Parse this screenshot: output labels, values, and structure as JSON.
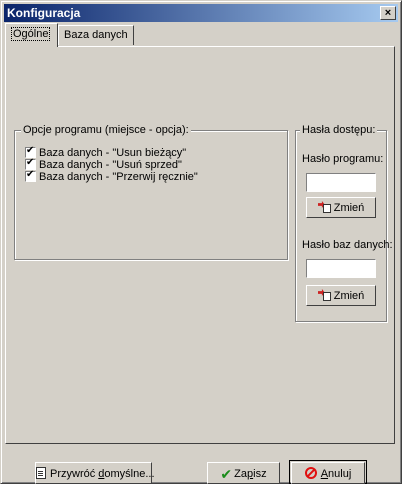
{
  "window": {
    "title": "Konfiguracja",
    "close_label": "×"
  },
  "tabs": [
    {
      "label": "Ogólne",
      "active": true
    },
    {
      "label": "Baza danych",
      "active": false
    }
  ],
  "options_group": {
    "legend": "Opcje programu (miejsce - opcja):",
    "items": [
      {
        "label": "Baza danych - \"Usun bieżący\"",
        "checked": true
      },
      {
        "label": "Baza danych - \"Usuń sprzed\"",
        "checked": true
      },
      {
        "label": "Baza danych - \"Przerwij ręcznie\"",
        "checked": true
      }
    ]
  },
  "passwords_group": {
    "legend": "Hasła dostępu:",
    "program_label": "Hasło programu:",
    "program_value": "",
    "program_button": "Zmień",
    "db_label": "Hasło baz danych:",
    "db_value": "",
    "db_button": "Zmień"
  },
  "footer": {
    "restore_pre": "Przywróć ",
    "restore_u": "d",
    "restore_post": "omyślne...",
    "save_pre": "Za",
    "save_u": "p",
    "save_post": "isz",
    "cancel_u": "A",
    "cancel_post": "nuluj"
  },
  "icons": {
    "close": "close-icon",
    "swap": "swap-icon",
    "restore": "document-icon",
    "save": "checkmark-icon",
    "cancel": "cancel-icon"
  },
  "colors": {
    "titlebar_start": "#0a246a",
    "titlebar_end": "#a6caf0",
    "face": "#d4d0c8"
  }
}
